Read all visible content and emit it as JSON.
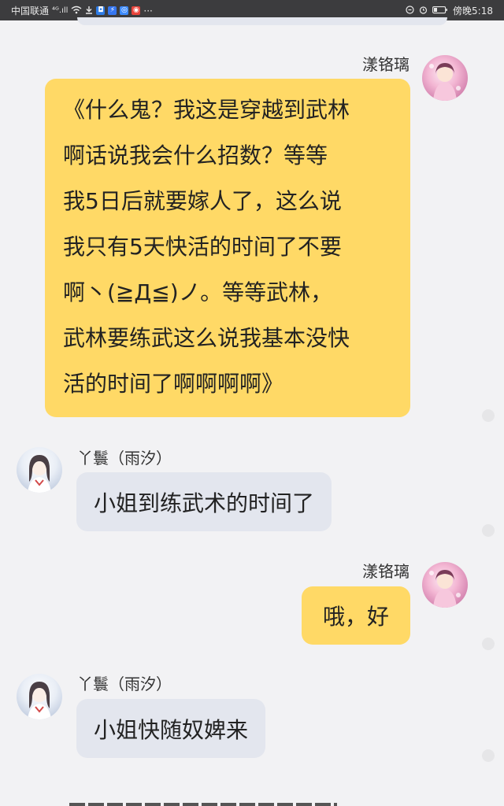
{
  "status_bar": {
    "carrier": "中国联通",
    "signal": "⁴ᴳ.ıll",
    "more": "···",
    "time": "傍晚5:18"
  },
  "colors": {
    "user_bubble": "#ffd966",
    "other_bubble": "#e3e6ee",
    "background": "#f2f2f4",
    "status_bar": "#3c3c3e"
  },
  "messages": [
    {
      "sender": "漾铬璃",
      "lines": [
        "《什么鬼？我这是穿越到武林",
        "啊话说我会什么招数？等等",
        "我5日后就要嫁人了，这么说",
        "我只有5天快活的时间了不要",
        "啊丶(≧Д≦)ノ。等等武林，",
        "武林要练武这么说我基本没快",
        "活的时间了啊啊啊啊》"
      ]
    },
    {
      "sender": "丫鬟（雨汐）",
      "text": "小姐到练武术的时间了"
    },
    {
      "sender": "漾铬璃",
      "text": "哦，好"
    },
    {
      "sender": "丫鬟（雨汐）",
      "text": "小姐快随奴婢来"
    }
  ]
}
